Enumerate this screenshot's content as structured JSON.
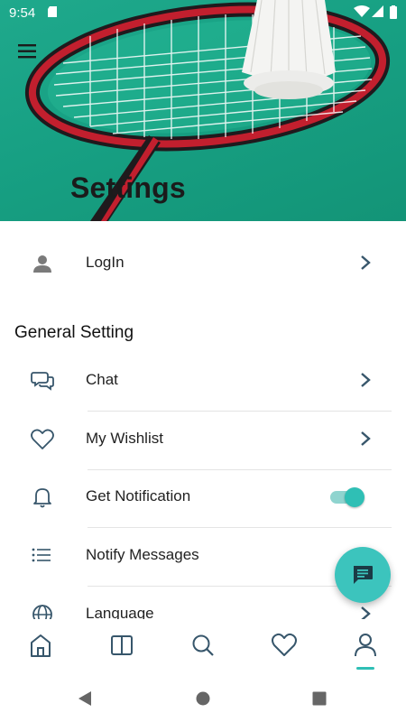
{
  "status_bar": {
    "time": "9:54"
  },
  "header": {
    "title": "Settings"
  },
  "login_item": {
    "label": "LogIn"
  },
  "general_section": {
    "title": "General Setting",
    "items": [
      {
        "label": "Chat"
      },
      {
        "label": "My Wishlist"
      },
      {
        "label": "Get Notification",
        "toggle_on": true
      },
      {
        "label": "Notify Messages"
      },
      {
        "label": "Language"
      }
    ]
  },
  "colors": {
    "accent": "#2fbfb5",
    "header_bg": "#17a083"
  },
  "bottom_nav": {
    "items": [
      "home-icon",
      "book-icon",
      "search-icon",
      "heart-icon",
      "user-icon"
    ],
    "active": "user-icon"
  }
}
